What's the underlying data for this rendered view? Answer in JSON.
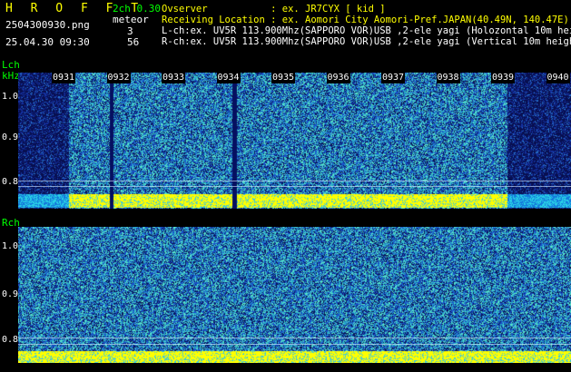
{
  "header": {
    "app_title": "H R O F F T",
    "filename": "2504300930.png",
    "datetime": "25.04.30 09:30",
    "channel_mode": "2ch 0.30",
    "meteor_label": "meteor",
    "meteor_lch": "3",
    "meteor_rch": "56",
    "observer_line": "Ovserver           : ex. JR7CYX [ kid ]",
    "location_line": "Receiving Location : ex. Aomori City Aomori-Pref.JAPAN(40.49N, 140.47E)",
    "lch_line": "L-ch:ex. UV5R 113.900Mhz(SAPPORO VOR)USB ,2-ele yagi (Holozontal 10m height)",
    "rch_line": "R-ch:ex. UV5R 113.900Mhz(SAPPORO VOR)USB ,2-ele yagi (Vertical 10m height)"
  },
  "lch_panel": {
    "label": "Lch",
    "unit": "kHz",
    "y_ticks": [
      "1.0",
      "0.9",
      "0.8"
    ],
    "time_markers": [
      "0931",
      "0932",
      "0933",
      "0934",
      "0935",
      "0936",
      "0937",
      "0938",
      "0939",
      "0940"
    ]
  },
  "rch_panel": {
    "label": "Rch",
    "y_ticks": [
      "1.0",
      "0.9",
      "0.8"
    ]
  },
  "colors": {
    "noise_dark": "#0a1a6e",
    "noise_mid": "#1e5fd0",
    "noise_cyan": "#33e0d0",
    "band_yellow": "#ffff00",
    "text_yellow": "#ffff00",
    "text_green": "#00ff00"
  }
}
